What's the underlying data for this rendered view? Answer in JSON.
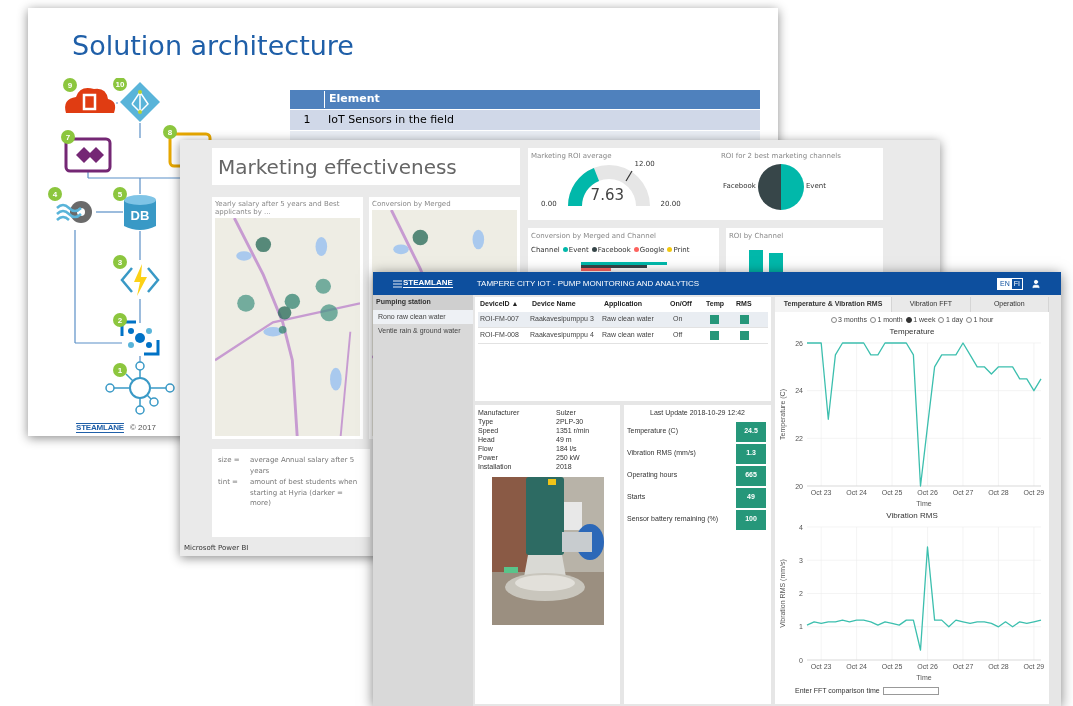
{
  "architecture_slide": {
    "title": "Solution architecture",
    "diagram": {
      "db_label": "DB",
      "nodes": [
        {
          "kind": "office",
          "badge": "9"
        },
        {
          "kind": "directory",
          "badge": "10"
        },
        {
          "kind": "apps",
          "badge": "7"
        },
        {
          "kind": "logic",
          "badge": "8"
        },
        {
          "kind": "analytics",
          "badge": "4"
        },
        {
          "kind": "database",
          "badge": "5"
        },
        {
          "kind": "function",
          "badge": "3"
        },
        {
          "kind": "hub",
          "badge": "2"
        },
        {
          "kind": "sensor",
          "badge": "1"
        }
      ]
    },
    "table": {
      "heading": "Element",
      "rows": [
        {
          "number": "1",
          "element": "IoT Sensors in the field"
        }
      ]
    },
    "footer": {
      "logo": "STEAMLANE",
      "copyright": "© 2017"
    }
  },
  "dashboard_slide": {
    "title": "Marketing effectiveness",
    "gauge": {
      "title": "Marketing ROI average",
      "value": "7.63",
      "min": "0.00",
      "target": "12.00",
      "max": "20.00",
      "level": 0.38
    },
    "pie": {
      "title": "ROI for 2 best marketing channels",
      "labels": [
        "Facebook",
        "Event"
      ]
    },
    "maps": [
      {
        "title": "Yearly salary after 5 years and Best applicants by ..."
      },
      {
        "title": "Conversion by Merged"
      }
    ],
    "conversion": {
      "title": "Conversion by Merged and Channel",
      "legend_title": "Channel",
      "legend": [
        {
          "label": "Event",
          "color": "#01b8aa"
        },
        {
          "label": "Facebook",
          "color": "#374649"
        },
        {
          "label": "Google",
          "color": "#fd625e"
        },
        {
          "label": "Print",
          "color": "#f2c80f"
        }
      ]
    },
    "roi": {
      "title": "ROI by Channel"
    },
    "notes": [
      {
        "key": "size =",
        "text": "average Annual salary after 5 years"
      },
      {
        "key": "tint =",
        "text": "amount of best students when starting at Hyria (darker = more)"
      }
    ],
    "footer": "Microsoft Power BI"
  },
  "monitoring_app": {
    "header": {
      "logo": "STEAMLANE",
      "title": "TAMPERE CITY IOT - PUMP MONITORING AND ANALYTICS",
      "languages": [
        {
          "label": "EN",
          "selected": true
        },
        {
          "label": "FI",
          "selected": false
        }
      ]
    },
    "sidebar": {
      "heading": "Pumping station",
      "items": [
        {
          "label": "Rono raw clean water",
          "selected": true
        },
        {
          "label": "Ventie rain & ground water",
          "selected": false
        }
      ]
    },
    "devices": {
      "columns": [
        {
          "label": "DeviceID",
          "sort": "▲"
        },
        {
          "label": "Device Name"
        },
        {
          "label": "Application"
        },
        {
          "label": "On/Off"
        },
        {
          "label": "Temp"
        },
        {
          "label": "RMS"
        }
      ],
      "rows": [
        {
          "device_id": "ROI-FM-007",
          "name": "Raakavesipumppu 3",
          "application": "Raw clean water",
          "state": "On",
          "temp": {
            "color": "#26977a"
          },
          "rms": {
            "color": "#26977a"
          },
          "selected": true
        },
        {
          "device_id": "ROI-FM-008",
          "name": "Raakavesipumppu 4",
          "application": "Raw clean water",
          "state": "Off",
          "temp": {
            "color": "#26977a"
          },
          "rms": {
            "color": "#26977a"
          },
          "selected": false
        }
      ]
    },
    "details": [
      {
        "label": "Manufacturer",
        "value": "Sulzer"
      },
      {
        "label": "Type",
        "value": "2PLP-30"
      },
      {
        "label": "Speed",
        "value": "1351 r/min"
      },
      {
        "label": "Head",
        "value": "49 m"
      },
      {
        "label": "Flow",
        "value": "184 l/s"
      },
      {
        "label": "Power",
        "value": "250 kW"
      },
      {
        "label": "Installation",
        "value": "2018"
      }
    ],
    "readings": {
      "last_update": "Last Update 2018-10-29 12:42",
      "items": [
        {
          "label": "Temperature (C)",
          "value": "24.5"
        },
        {
          "label": "Vibration RMS (mm/s)",
          "value": "1.3"
        },
        {
          "label": "Operating hours",
          "value": "665"
        },
        {
          "label": "Starts",
          "value": "49"
        },
        {
          "label": "Sensor battery remaining (%)",
          "value": "100"
        }
      ]
    },
    "tabs": [
      {
        "label": "Temperature & Vibration RMS",
        "selected": true
      },
      {
        "label": "Vibration FFT",
        "selected": false
      },
      {
        "label": "Operation",
        "selected": false
      }
    ],
    "ranges": [
      {
        "label": "3 months",
        "selected": false
      },
      {
        "label": "1 month",
        "selected": false
      },
      {
        "label": "1 week",
        "selected": true
      },
      {
        "label": "1 day",
        "selected": false
      },
      {
        "label": "1 hour",
        "selected": false
      }
    ],
    "charts": [
      {
        "chart_data": {
          "type": "line",
          "title": "Temperature",
          "xlabel": "Time",
          "ylabel": "Temperature (C)",
          "categories": [
            null,
            null,
            "Oct 23",
            null,
            null,
            null,
            null,
            "Oct 24",
            null,
            null,
            null,
            null,
            "Oct 25",
            null,
            null,
            null,
            null,
            "Oct 26",
            null,
            null,
            null,
            null,
            "Oct 27",
            null,
            null,
            null,
            null,
            "Oct 28",
            null,
            null,
            null,
            null,
            "Oct 29",
            null
          ],
          "series": [
            {
              "color": "#3cbfae",
              "values": [
                26,
                26,
                26,
                22.8,
                25.5,
                26,
                26,
                26,
                26,
                25.5,
                25.5,
                26,
                26,
                26,
                26,
                25.5,
                20,
                22.5,
                25,
                25.5,
                25.5,
                25.5,
                26,
                25.5,
                25,
                25,
                24.7,
                25,
                25,
                25,
                24.5,
                24.5,
                24,
                24.5
              ]
            }
          ],
          "ylim": [
            20,
            26
          ],
          "grid": true,
          "yticks": [
            20,
            22,
            24,
            26
          ]
        }
      },
      {
        "chart_data": {
          "type": "line",
          "title": "Vibration RMS",
          "xlabel": "Time",
          "ylabel": "Vibration RMS (mm/s)",
          "categories": [
            null,
            null,
            "Oct 23",
            null,
            null,
            null,
            null,
            "Oct 24",
            null,
            null,
            null,
            null,
            "Oct 25",
            null,
            null,
            null,
            null,
            "Oct 26",
            null,
            null,
            null,
            null,
            "Oct 27",
            null,
            null,
            null,
            null,
            "Oct 28",
            null,
            null,
            null,
            null,
            "Oct 29",
            null
          ],
          "series": [
            {
              "color": "#3cbfae",
              "values": [
                1.05,
                1.15,
                1.1,
                1.15,
                1.15,
                1.2,
                1.15,
                1.2,
                1.2,
                1.15,
                1.05,
                1.15,
                1.1,
                1.05,
                1.2,
                1.2,
                0.3,
                3.4,
                1.2,
                1.2,
                1.0,
                1.2,
                1.15,
                1.1,
                1.15,
                1.15,
                1.1,
                1.0,
                1.15,
                1.0,
                1.15,
                1.1,
                1.15,
                1.2
              ]
            }
          ],
          "ylim": [
            0,
            4
          ],
          "grid": true,
          "yticks": [
            0,
            1,
            2,
            3,
            4
          ]
        }
      }
    ],
    "fft": {
      "label": "Enter FFT comparison time"
    }
  }
}
